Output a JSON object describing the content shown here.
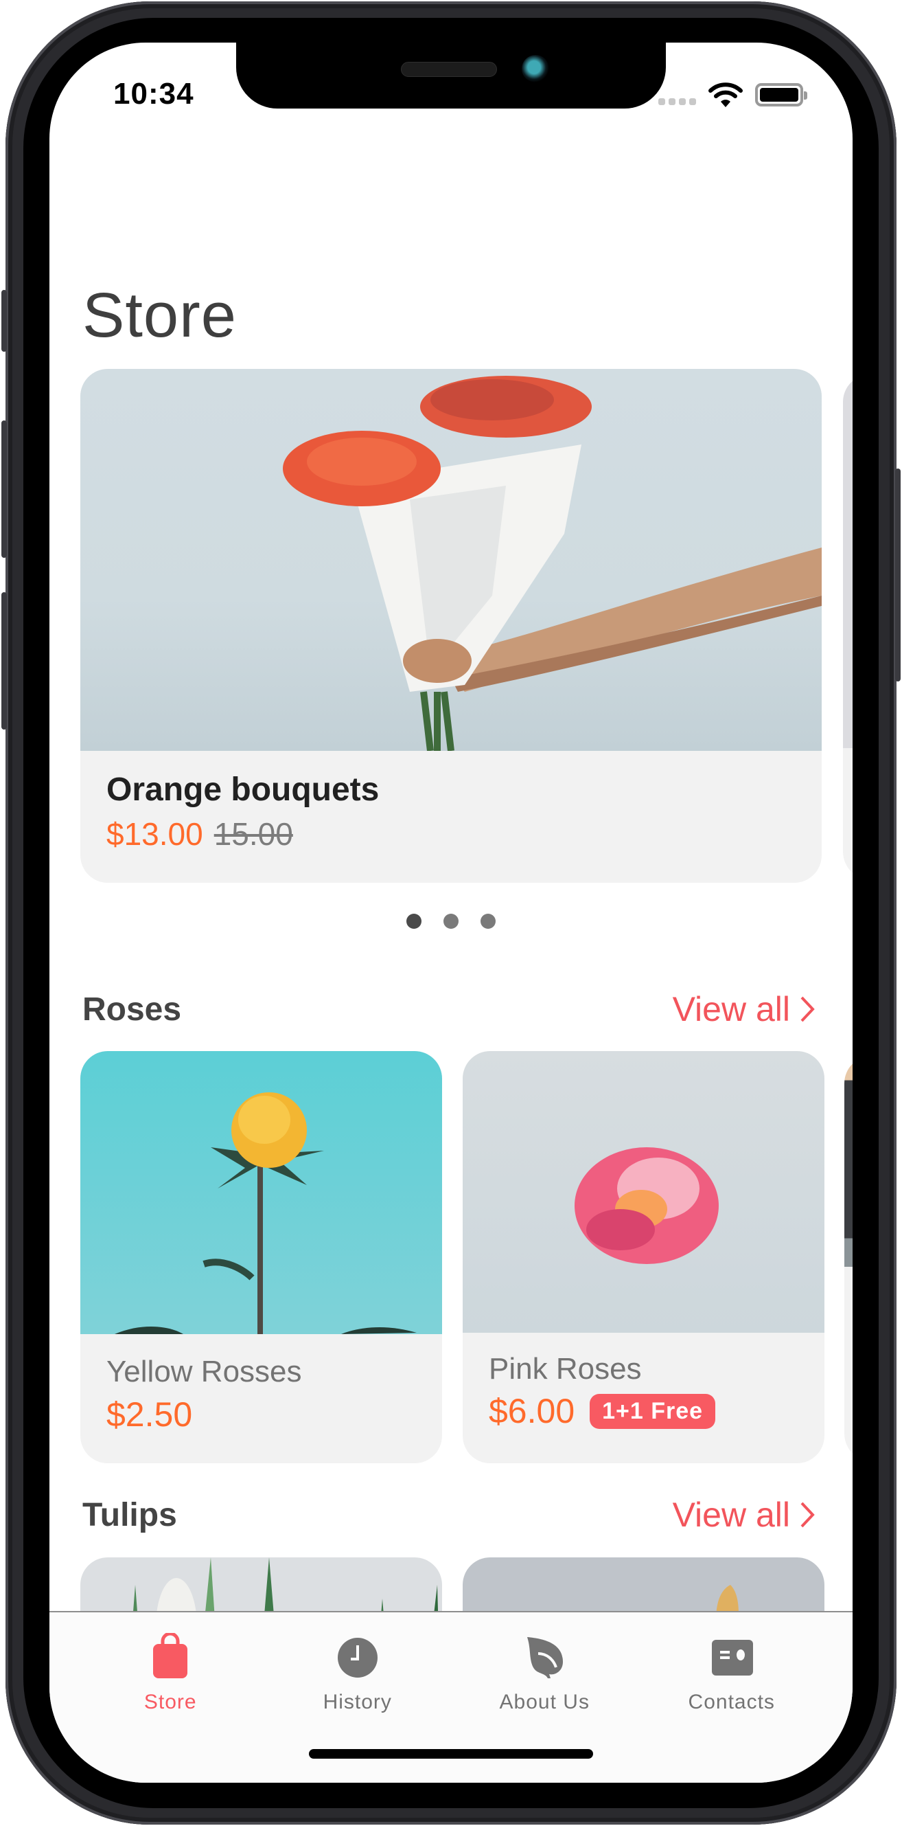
{
  "status_bar": {
    "time": "10:34",
    "icons": [
      "signal-icon",
      "wifi-icon",
      "battery-icon"
    ]
  },
  "header": {
    "title": "Store"
  },
  "featured": {
    "items": [
      {
        "name": "Orange bouquets",
        "price": "$13.00",
        "original_price": "15.00"
      }
    ],
    "page_count": 3,
    "active_page": 1
  },
  "sections": [
    {
      "title": "Roses",
      "view_all_label": "View all",
      "products": [
        {
          "name": "Yellow Rosses",
          "price": "$2.50",
          "badge": ""
        },
        {
          "name": "Pink Roses",
          "price": "$6.00",
          "badge": "1+1 Free"
        }
      ]
    },
    {
      "title": "Tulips",
      "view_all_label": "View all",
      "products": []
    }
  ],
  "tab_bar": {
    "active": "Store",
    "tabs": [
      {
        "label": "Store",
        "icon": "shopping-bag-icon"
      },
      {
        "label": "History",
        "icon": "clock-icon"
      },
      {
        "label": "About Us",
        "icon": "leaf-icon"
      },
      {
        "label": "Contacts",
        "icon": "contact-card-icon"
      }
    ]
  },
  "colors": {
    "accent": "#f85a62",
    "price": "#ff6a2b",
    "card_bg": "#f2f2f2",
    "inactive_tab": "#737373"
  }
}
